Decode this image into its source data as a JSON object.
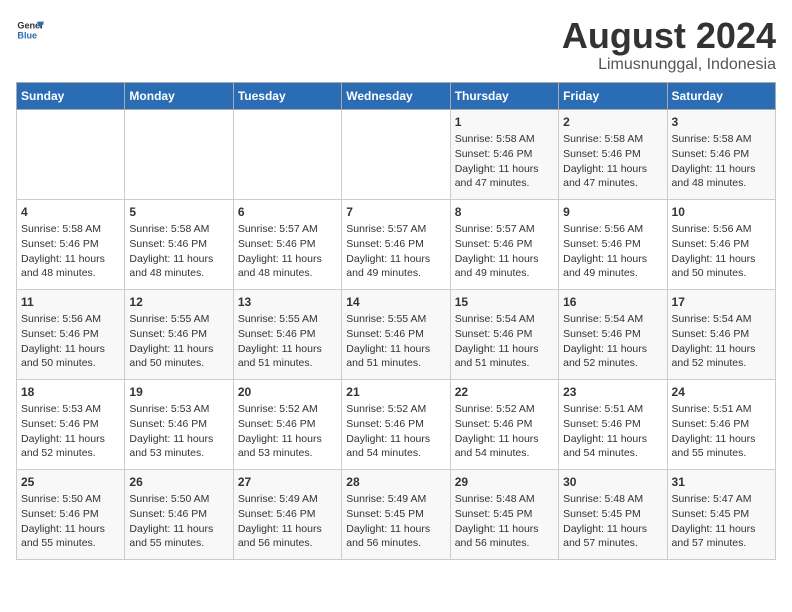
{
  "header": {
    "logo_line1": "General",
    "logo_line2": "Blue",
    "title": "August 2024",
    "subtitle": "Limusnunggal, Indonesia"
  },
  "days_of_week": [
    "Sunday",
    "Monday",
    "Tuesday",
    "Wednesday",
    "Thursday",
    "Friday",
    "Saturday"
  ],
  "weeks": [
    [
      {
        "day": "",
        "info": ""
      },
      {
        "day": "",
        "info": ""
      },
      {
        "day": "",
        "info": ""
      },
      {
        "day": "",
        "info": ""
      },
      {
        "day": "1",
        "info": "Sunrise: 5:58 AM\nSunset: 5:46 PM\nDaylight: 11 hours\nand 47 minutes."
      },
      {
        "day": "2",
        "info": "Sunrise: 5:58 AM\nSunset: 5:46 PM\nDaylight: 11 hours\nand 47 minutes."
      },
      {
        "day": "3",
        "info": "Sunrise: 5:58 AM\nSunset: 5:46 PM\nDaylight: 11 hours\nand 48 minutes."
      }
    ],
    [
      {
        "day": "4",
        "info": "Sunrise: 5:58 AM\nSunset: 5:46 PM\nDaylight: 11 hours\nand 48 minutes."
      },
      {
        "day": "5",
        "info": "Sunrise: 5:58 AM\nSunset: 5:46 PM\nDaylight: 11 hours\nand 48 minutes."
      },
      {
        "day": "6",
        "info": "Sunrise: 5:57 AM\nSunset: 5:46 PM\nDaylight: 11 hours\nand 48 minutes."
      },
      {
        "day": "7",
        "info": "Sunrise: 5:57 AM\nSunset: 5:46 PM\nDaylight: 11 hours\nand 49 minutes."
      },
      {
        "day": "8",
        "info": "Sunrise: 5:57 AM\nSunset: 5:46 PM\nDaylight: 11 hours\nand 49 minutes."
      },
      {
        "day": "9",
        "info": "Sunrise: 5:56 AM\nSunset: 5:46 PM\nDaylight: 11 hours\nand 49 minutes."
      },
      {
        "day": "10",
        "info": "Sunrise: 5:56 AM\nSunset: 5:46 PM\nDaylight: 11 hours\nand 50 minutes."
      }
    ],
    [
      {
        "day": "11",
        "info": "Sunrise: 5:56 AM\nSunset: 5:46 PM\nDaylight: 11 hours\nand 50 minutes."
      },
      {
        "day": "12",
        "info": "Sunrise: 5:55 AM\nSunset: 5:46 PM\nDaylight: 11 hours\nand 50 minutes."
      },
      {
        "day": "13",
        "info": "Sunrise: 5:55 AM\nSunset: 5:46 PM\nDaylight: 11 hours\nand 51 minutes."
      },
      {
        "day": "14",
        "info": "Sunrise: 5:55 AM\nSunset: 5:46 PM\nDaylight: 11 hours\nand 51 minutes."
      },
      {
        "day": "15",
        "info": "Sunrise: 5:54 AM\nSunset: 5:46 PM\nDaylight: 11 hours\nand 51 minutes."
      },
      {
        "day": "16",
        "info": "Sunrise: 5:54 AM\nSunset: 5:46 PM\nDaylight: 11 hours\nand 52 minutes."
      },
      {
        "day": "17",
        "info": "Sunrise: 5:54 AM\nSunset: 5:46 PM\nDaylight: 11 hours\nand 52 minutes."
      }
    ],
    [
      {
        "day": "18",
        "info": "Sunrise: 5:53 AM\nSunset: 5:46 PM\nDaylight: 11 hours\nand 52 minutes."
      },
      {
        "day": "19",
        "info": "Sunrise: 5:53 AM\nSunset: 5:46 PM\nDaylight: 11 hours\nand 53 minutes."
      },
      {
        "day": "20",
        "info": "Sunrise: 5:52 AM\nSunset: 5:46 PM\nDaylight: 11 hours\nand 53 minutes."
      },
      {
        "day": "21",
        "info": "Sunrise: 5:52 AM\nSunset: 5:46 PM\nDaylight: 11 hours\nand 54 minutes."
      },
      {
        "day": "22",
        "info": "Sunrise: 5:52 AM\nSunset: 5:46 PM\nDaylight: 11 hours\nand 54 minutes."
      },
      {
        "day": "23",
        "info": "Sunrise: 5:51 AM\nSunset: 5:46 PM\nDaylight: 11 hours\nand 54 minutes."
      },
      {
        "day": "24",
        "info": "Sunrise: 5:51 AM\nSunset: 5:46 PM\nDaylight: 11 hours\nand 55 minutes."
      }
    ],
    [
      {
        "day": "25",
        "info": "Sunrise: 5:50 AM\nSunset: 5:46 PM\nDaylight: 11 hours\nand 55 minutes."
      },
      {
        "day": "26",
        "info": "Sunrise: 5:50 AM\nSunset: 5:46 PM\nDaylight: 11 hours\nand 55 minutes."
      },
      {
        "day": "27",
        "info": "Sunrise: 5:49 AM\nSunset: 5:46 PM\nDaylight: 11 hours\nand 56 minutes."
      },
      {
        "day": "28",
        "info": "Sunrise: 5:49 AM\nSunset: 5:45 PM\nDaylight: 11 hours\nand 56 minutes."
      },
      {
        "day": "29",
        "info": "Sunrise: 5:48 AM\nSunset: 5:45 PM\nDaylight: 11 hours\nand 56 minutes."
      },
      {
        "day": "30",
        "info": "Sunrise: 5:48 AM\nSunset: 5:45 PM\nDaylight: 11 hours\nand 57 minutes."
      },
      {
        "day": "31",
        "info": "Sunrise: 5:47 AM\nSunset: 5:45 PM\nDaylight: 11 hours\nand 57 minutes."
      }
    ]
  ]
}
